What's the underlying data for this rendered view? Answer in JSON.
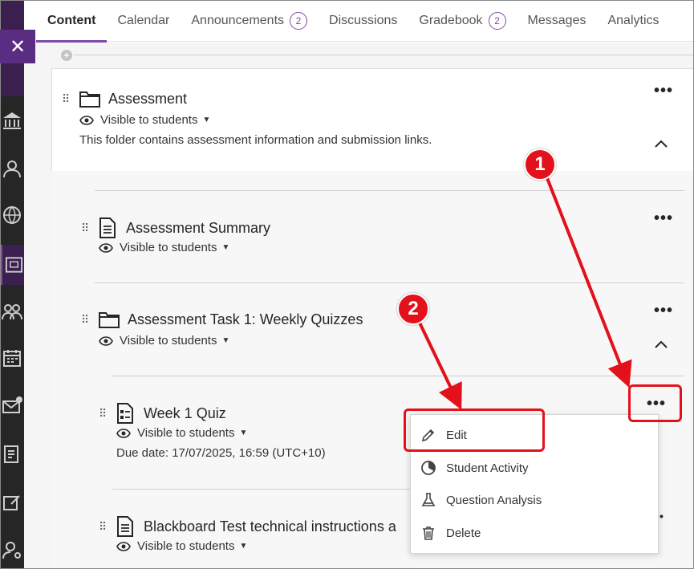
{
  "tabs": [
    {
      "label": "Content",
      "badge": null
    },
    {
      "label": "Calendar",
      "badge": null
    },
    {
      "label": "Announcements",
      "badge": "2"
    },
    {
      "label": "Discussions",
      "badge": null
    },
    {
      "label": "Gradebook",
      "badge": "2"
    },
    {
      "label": "Messages",
      "badge": null
    },
    {
      "label": "Analytics",
      "badge": null
    }
  ],
  "close_glyph": "✕",
  "add_glyph": "+",
  "folder": {
    "title": "Assessment",
    "visibility": "Visible to students",
    "description": "This folder contains assessment information and submission links."
  },
  "items": [
    {
      "title": "Assessment Summary",
      "visibility": "Visible to students",
      "icon": "document-icon"
    },
    {
      "title": "Assessment Task 1: Weekly Quizzes",
      "visibility": "Visible to students",
      "icon": "folder-icon"
    }
  ],
  "quiz": {
    "title": "Week 1 Quiz",
    "visibility": "Visible to students",
    "due": "Due date: 17/07/2025, 16:59 (UTC+10)"
  },
  "blackboard": {
    "title": "Blackboard Test technical instructions a",
    "visibility": "Visible to students"
  },
  "menu": [
    {
      "label": "Edit",
      "icon": "pencil-icon"
    },
    {
      "label": "Student Activity",
      "icon": "pie-chart-icon"
    },
    {
      "label": "Question Analysis",
      "icon": "flask-icon"
    },
    {
      "label": "Delete",
      "icon": "trash-icon"
    }
  ],
  "annotations": {
    "step1": "1",
    "step2": "2",
    "color": "#e3111b"
  },
  "colors": {
    "accent": "#7d4ca8",
    "nav": "#262626",
    "close": "#5a2d82"
  }
}
